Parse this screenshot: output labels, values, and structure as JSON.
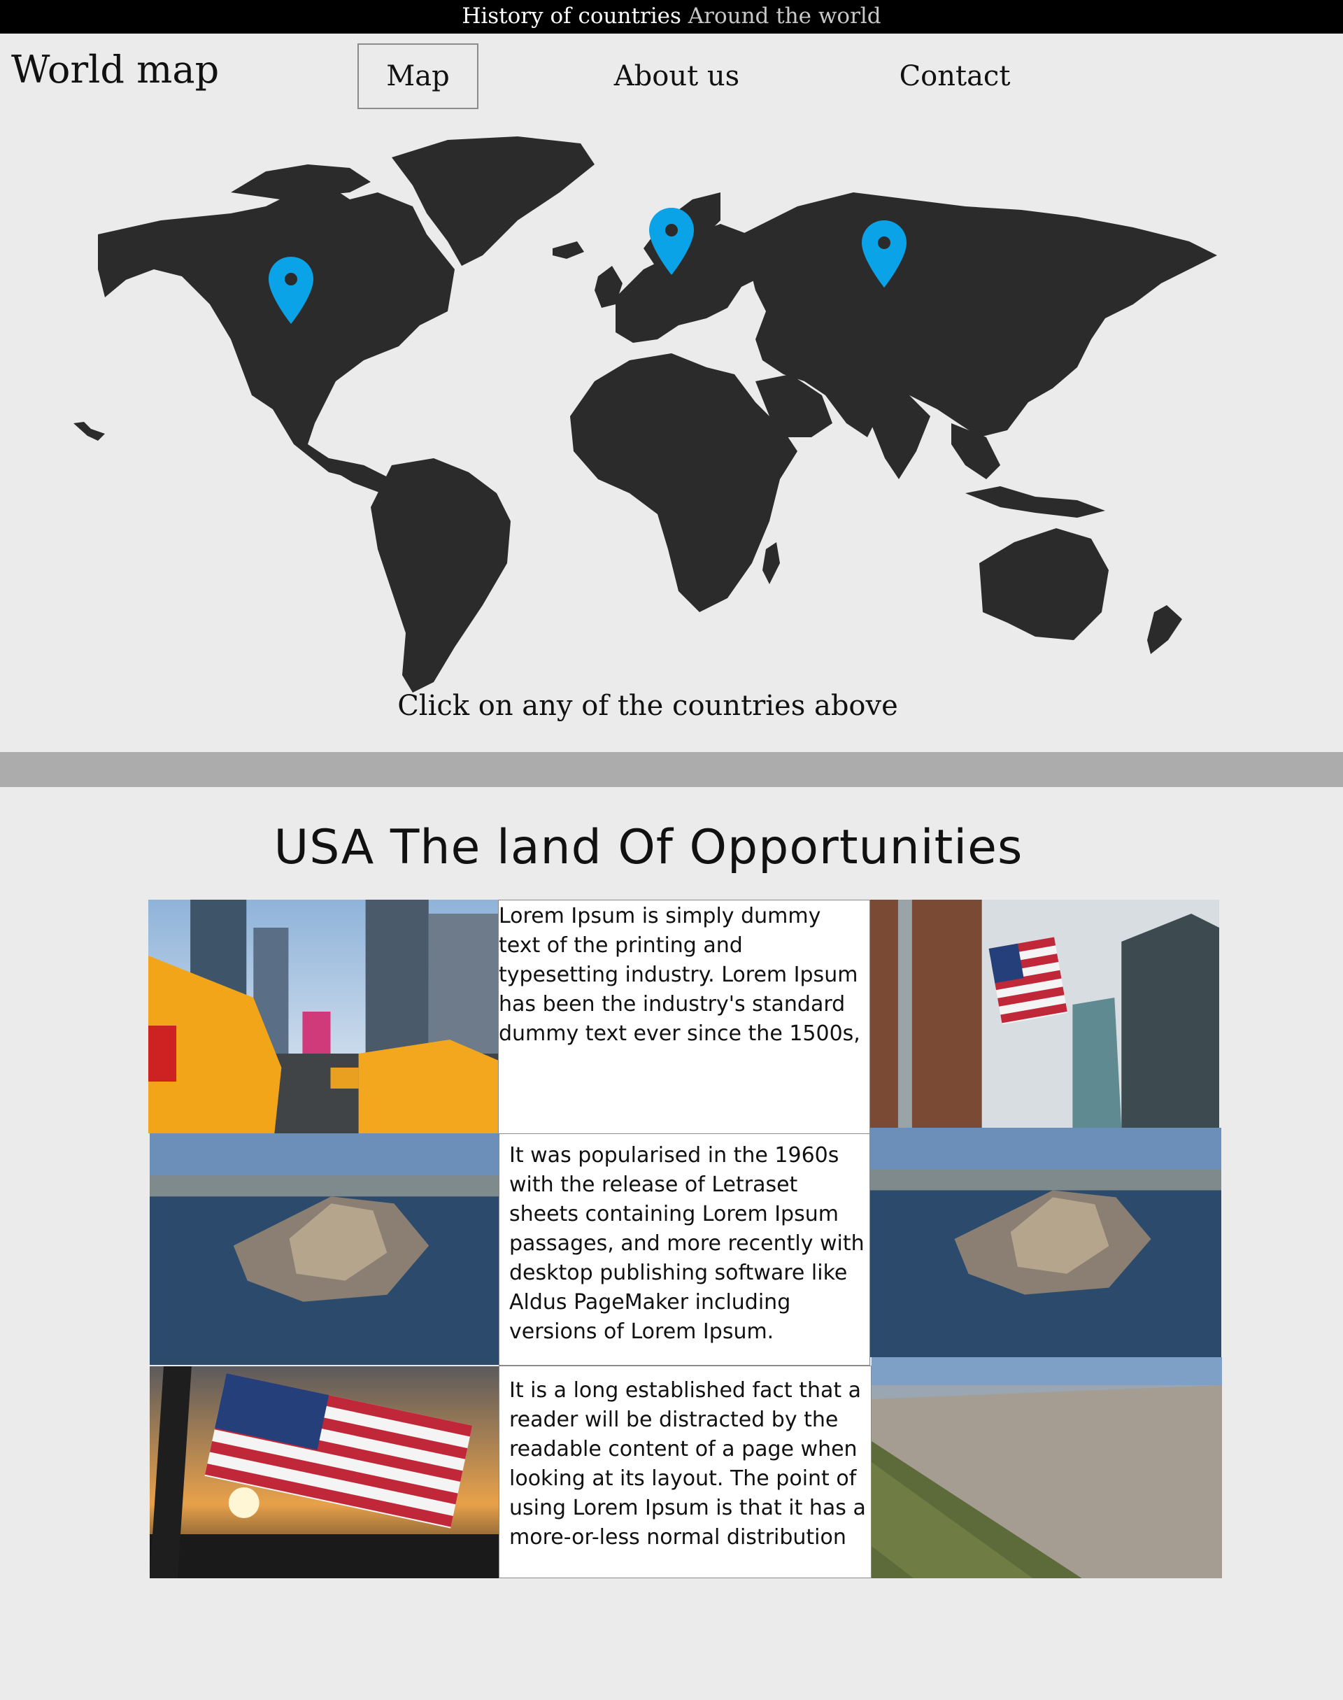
{
  "topbar": {
    "title": "History of countries",
    "subtitle": "Around the world"
  },
  "brand": "World map",
  "nav": {
    "map": "Map",
    "about": "About us",
    "contact": "Contact"
  },
  "colors": {
    "pin": "#0aa3e8",
    "land": "#2b2b2b",
    "background": "#ebebeb"
  },
  "map_caption": "Click on any of the countries above",
  "section": {
    "headline": "USA The land Of Opportunities",
    "paragraphs": [
      "Lorem Ipsum is simply dummy text of the printing and typesetting industry. Lorem Ipsum has been the industry's standard dummy text ever since the 1500s,",
      "It was popularised in the 1960s with the release of Letraset sheets containing Lorem Ipsum passages, and more recently with desktop publishing software like Aldus PageMaker including versions of Lorem Ipsum.",
      "It is a long established fact that a reader will be distracted by the readable content of a page when looking at its layout. The point of using Lorem Ipsum is that it has a more-or-less normal distribution"
    ]
  }
}
